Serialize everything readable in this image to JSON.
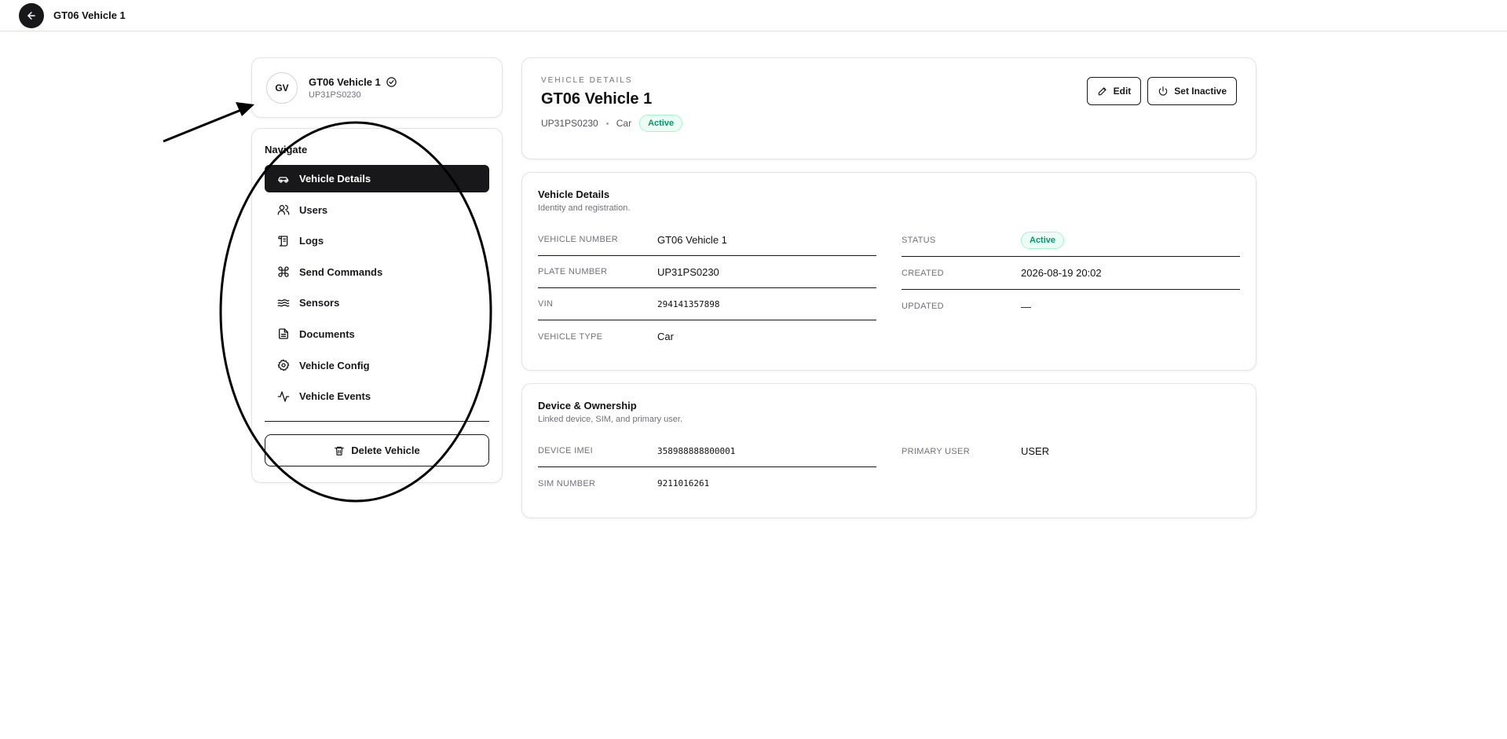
{
  "topbar": {
    "title": "GT06 Vehicle 1",
    "back_icon": "arrow-left-icon"
  },
  "profile": {
    "initials": "GV",
    "name": "GT06 Vehicle 1",
    "plate": "UP31PS0230",
    "verified_icon": "check-circle-icon"
  },
  "nav": {
    "heading": "Navigate",
    "items": [
      {
        "label": "Vehicle Details",
        "icon": "car-icon",
        "active": true
      },
      {
        "label": "Users",
        "icon": "users-icon"
      },
      {
        "label": "Logs",
        "icon": "scroll-icon"
      },
      {
        "label": "Send Commands",
        "icon": "command-icon"
      },
      {
        "label": "Sensors",
        "icon": "waves-icon"
      },
      {
        "label": "Documents",
        "icon": "file-text-icon"
      },
      {
        "label": "Vehicle Config",
        "icon": "gear-icon"
      },
      {
        "label": "Vehicle Events",
        "icon": "activity-icon"
      }
    ],
    "delete_label": "Delete Vehicle"
  },
  "header": {
    "eyebrow": "VEHICLE DETAILS",
    "title": "GT06 Vehicle 1",
    "plate": "UP31PS0230",
    "type": "Car",
    "status": "Active",
    "edit_label": "Edit",
    "inactive_label": "Set Inactive"
  },
  "details": {
    "title": "Vehicle Details",
    "subtitle": "Identity and registration.",
    "left": [
      {
        "label": "VEHICLE NUMBER",
        "value": "GT06 Vehicle 1"
      },
      {
        "label": "PLATE NUMBER",
        "value": "UP31PS0230"
      },
      {
        "label": "VIN",
        "value": "294141357898"
      },
      {
        "label": "VEHICLE TYPE",
        "value": "Car"
      }
    ],
    "right": [
      {
        "label": "STATUS",
        "value": "Active"
      },
      {
        "label": "CREATED",
        "value": "2026-08-19 20:02"
      },
      {
        "label": "UPDATED",
        "value": "—"
      }
    ]
  },
  "device": {
    "title": "Device & Ownership",
    "subtitle": "Linked device, SIM, and primary user.",
    "left": [
      {
        "label": "DEVICE IMEI",
        "value": "358988888800001"
      },
      {
        "label": "SIM NUMBER",
        "value": "9211016261"
      }
    ],
    "right": [
      {
        "label": "PRIMARY USER",
        "value": "USER"
      }
    ]
  },
  "colors": {
    "dark": "#18181b",
    "active_green": "#059669",
    "active_bg": "#ecfdf5",
    "muted": "#71717a"
  }
}
